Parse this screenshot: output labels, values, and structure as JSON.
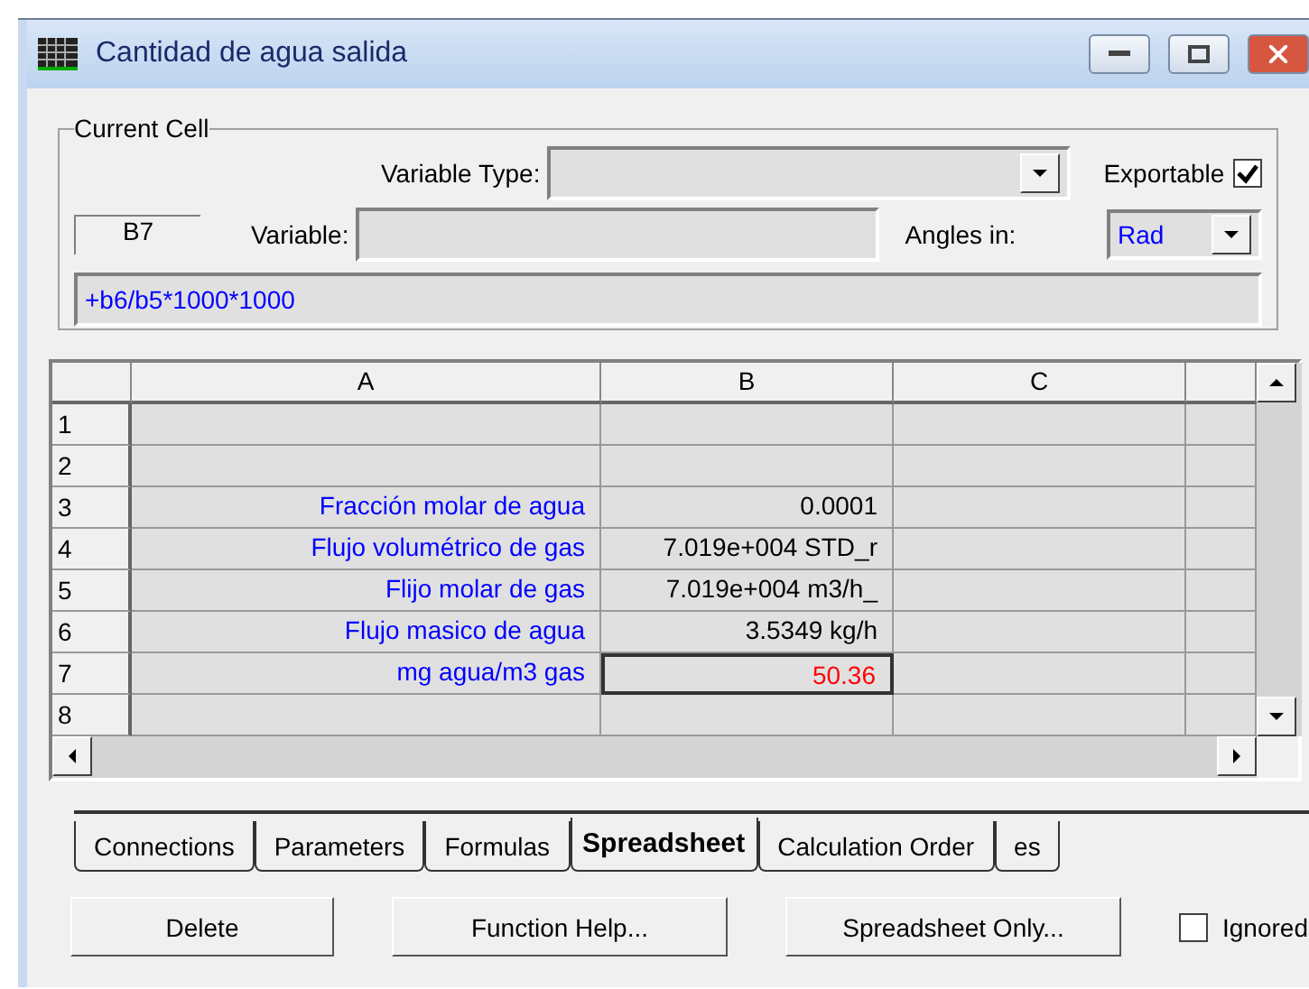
{
  "window": {
    "title": "Cantidad de agua salida"
  },
  "current_cell": {
    "group_label": "Current Cell",
    "variable_type_label": "Variable Type:",
    "cell_ref": "B7",
    "variable_label": "Variable:",
    "exportable_label": "Exportable",
    "exportable_checked": true,
    "angles_label": "Angles in:",
    "angles_value": "Rad",
    "formula": "+b6/b5*1000*1000"
  },
  "table": {
    "columns": [
      "A",
      "B",
      "C"
    ],
    "rows": [
      {
        "header": "1",
        "cells": [
          {
            "text": "",
            "selected": false
          },
          {
            "text": "",
            "selected": false
          },
          {
            "text": "",
            "selected": false
          }
        ]
      },
      {
        "header": "2",
        "cells": [
          {
            "text": "",
            "selected": false
          },
          {
            "text": "",
            "selected": false
          },
          {
            "text": "",
            "selected": false
          }
        ]
      },
      {
        "header": "3",
        "cells": [
          {
            "text": "Fracción molar de agua",
            "selected": false
          },
          {
            "text": "0.0001",
            "selected": false
          },
          {
            "text": "",
            "selected": false
          }
        ]
      },
      {
        "header": "4",
        "cells": [
          {
            "text": "Flujo volumétrico  de gas",
            "selected": false
          },
          {
            "text": "7.019e+004 STD_r",
            "selected": false
          },
          {
            "text": "",
            "selected": false
          }
        ]
      },
      {
        "header": "5",
        "cells": [
          {
            "text": "Flijo molar de gas",
            "selected": false
          },
          {
            "text": "7.019e+004 m3/h_",
            "selected": false
          },
          {
            "text": "",
            "selected": false
          }
        ]
      },
      {
        "header": "6",
        "cells": [
          {
            "text": "Flujo masico de agua",
            "selected": false
          },
          {
            "text": "3.5349 kg/h",
            "selected": false
          },
          {
            "text": "",
            "selected": false
          }
        ]
      },
      {
        "header": "7",
        "cells": [
          {
            "text": "mg agua/m3 gas",
            "selected": false
          },
          {
            "text": "50.36",
            "selected": true
          },
          {
            "text": "",
            "selected": false
          }
        ]
      },
      {
        "header": "8",
        "cells": [
          {
            "text": "",
            "selected": false
          },
          {
            "text": "",
            "selected": false
          },
          {
            "text": "",
            "selected": false
          }
        ]
      }
    ]
  },
  "tabs": [
    {
      "label": "Connections",
      "selected": false
    },
    {
      "label": "Parameters",
      "selected": false
    },
    {
      "label": "Formulas",
      "selected": false
    },
    {
      "label": "Spreadsheet",
      "selected": true
    },
    {
      "label": "Calculation Order",
      "selected": false
    },
    {
      "label": "es",
      "selected": false
    }
  ],
  "buttons": [
    "Delete",
    "Function Help...",
    "Spreadsheet Only..."
  ],
  "ignored": {
    "label": "Ignored",
    "checked": false
  }
}
